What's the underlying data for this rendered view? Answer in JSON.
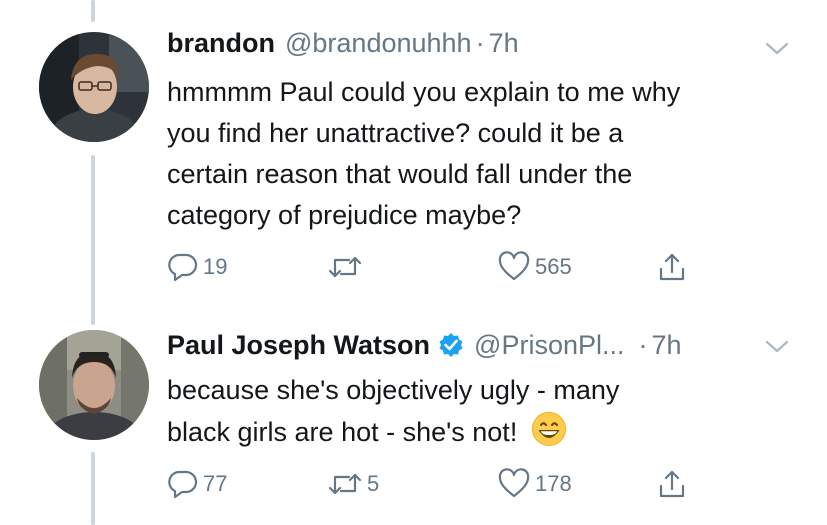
{
  "tweets": [
    {
      "name": "brandon",
      "handle": "@brandonuhhh",
      "separator": "·",
      "time": "7h",
      "lines": [
        "hmmmm Paul could you explain to me why",
        "you find her unattractive? could it be a",
        "certain reason that would fall under the",
        "category of prejudice maybe?"
      ],
      "reply_count": "19",
      "retweet_count": "",
      "like_count": "565",
      "icons": [
        "reply-icon",
        "retweet-icon",
        "like-icon",
        "share-icon",
        "chevron-down-icon"
      ]
    },
    {
      "name": "Paul Joseph Watson",
      "handle": "@PrisonPl...",
      "separator": "·",
      "time": "7h",
      "verified": true,
      "lines": [
        "because she's objectively ugly -  many",
        "black girls are hot - she's not!"
      ],
      "emoji": "grinning-face-emoji",
      "reply_count": "77",
      "retweet_count": "5",
      "like_count": "178",
      "icons": [
        "reply-icon",
        "retweet-icon",
        "like-icon",
        "share-icon",
        "chevron-down-icon",
        "verified-badge-icon"
      ]
    }
  ],
  "colors": {
    "text": "#14171a",
    "secondary": "#657786",
    "thread_line": "#ccd6dd",
    "verified": "#1da1f2"
  }
}
